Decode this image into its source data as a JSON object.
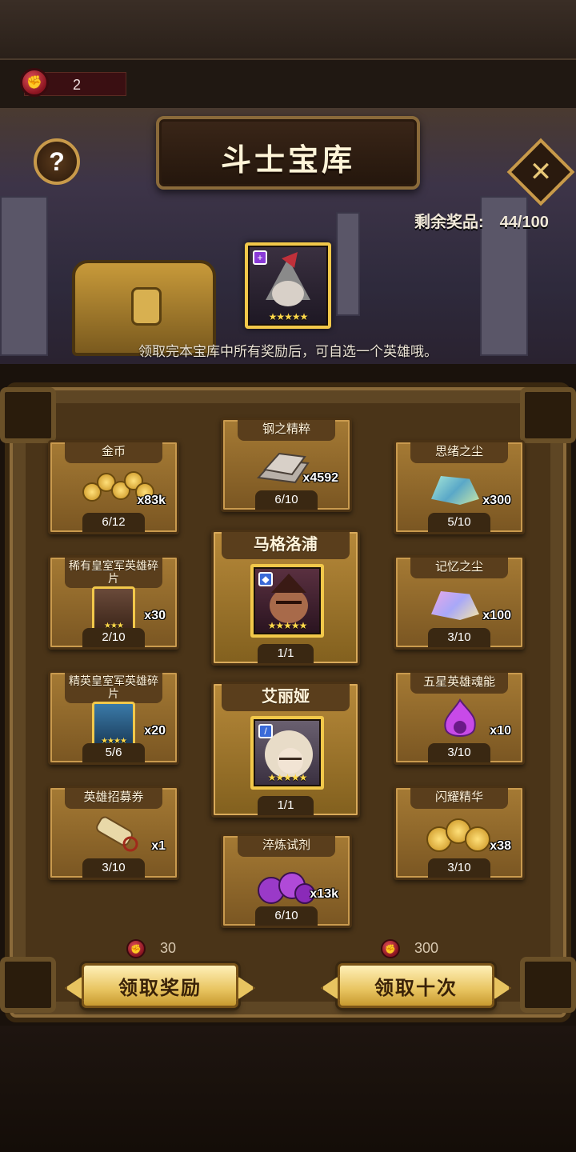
{
  "currency": {
    "value": "2"
  },
  "banner": {
    "title": "斗士宝库",
    "help_label": "?",
    "close_label": "✕",
    "remaining_label": "剩余奖品:",
    "remaining_value": "44/100",
    "note": "领取完本宝库中所有奖励后，可自选一个英雄哦。",
    "hero_stars": "★★★★★"
  },
  "rewards": {
    "gold": {
      "name": "金币",
      "qty": "x83k",
      "count": "6/12"
    },
    "steel": {
      "name": "钢之精粹",
      "qty": "x4592",
      "count": "6/10"
    },
    "thought_dust": {
      "name": "思绪之尘",
      "qty": "x300",
      "count": "5/10"
    },
    "rare_shard": {
      "name": "稀有皇室军英雄碎片",
      "qty": "x30",
      "count": "2/10",
      "stars": "★★★"
    },
    "memory_dust": {
      "name": "记忆之尘",
      "qty": "x100",
      "count": "3/10"
    },
    "elite_shard": {
      "name": "精英皇室军英雄碎片",
      "qty": "x20",
      "count": "5/6",
      "stars": "★★★★"
    },
    "five_star_soul": {
      "name": "五星英雄魂能",
      "qty": "x10",
      "count": "3/10"
    },
    "recruit_scroll": {
      "name": "英雄招募券",
      "qty": "x1",
      "count": "3/10"
    },
    "shine_essence": {
      "name": "闪耀精华",
      "qty": "x38",
      "count": "3/10"
    },
    "temper_potion": {
      "name": "淬炼试剂",
      "qty": "x13k",
      "count": "6/10"
    },
    "hero1": {
      "name": "马格洛浦",
      "count": "1/1",
      "stars": "★★★★★"
    },
    "hero2": {
      "name": "艾丽娅",
      "count": "1/1",
      "stars": "★★★★★"
    }
  },
  "actions": {
    "claim_one": {
      "label": "领取奖励",
      "cost": "30"
    },
    "claim_ten": {
      "label": "领取十次",
      "cost": "300"
    }
  },
  "colors": {
    "accent_gold": "#f2c84a",
    "currency_red": "#c8202e",
    "panel_brown": "#5e4624"
  }
}
